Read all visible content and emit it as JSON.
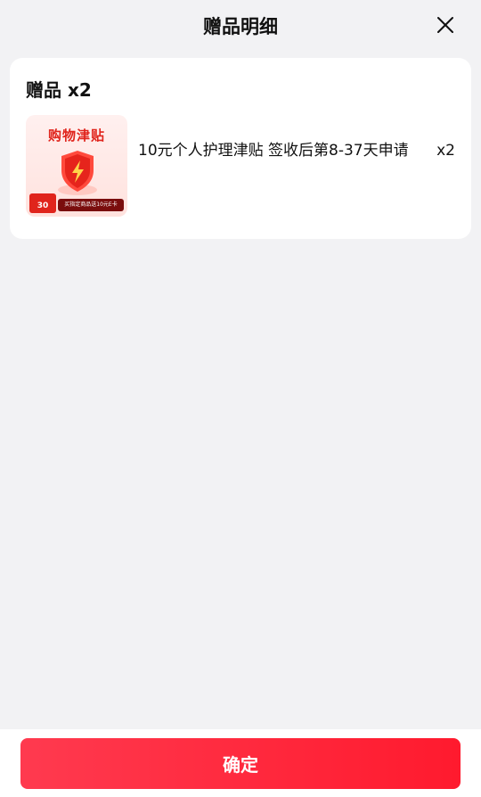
{
  "header": {
    "title": "赠品明细",
    "close_icon": "close-icon"
  },
  "gift_card": {
    "heading": "赠品 x2",
    "items": [
      {
        "thumbnail": {
          "title": "购物津贴",
          "badge": "30",
          "strip": "买指定商品送10元E卡",
          "icon": "shield-lightning-icon"
        },
        "name": "10元个人护理津贴 签收后第8-37天申请",
        "quantity": "x2"
      }
    ]
  },
  "footer": {
    "confirm_label": "确定"
  },
  "colors": {
    "background": "#f2f2f4",
    "card": "#ffffff",
    "accent_red": "#ff1a2e"
  }
}
